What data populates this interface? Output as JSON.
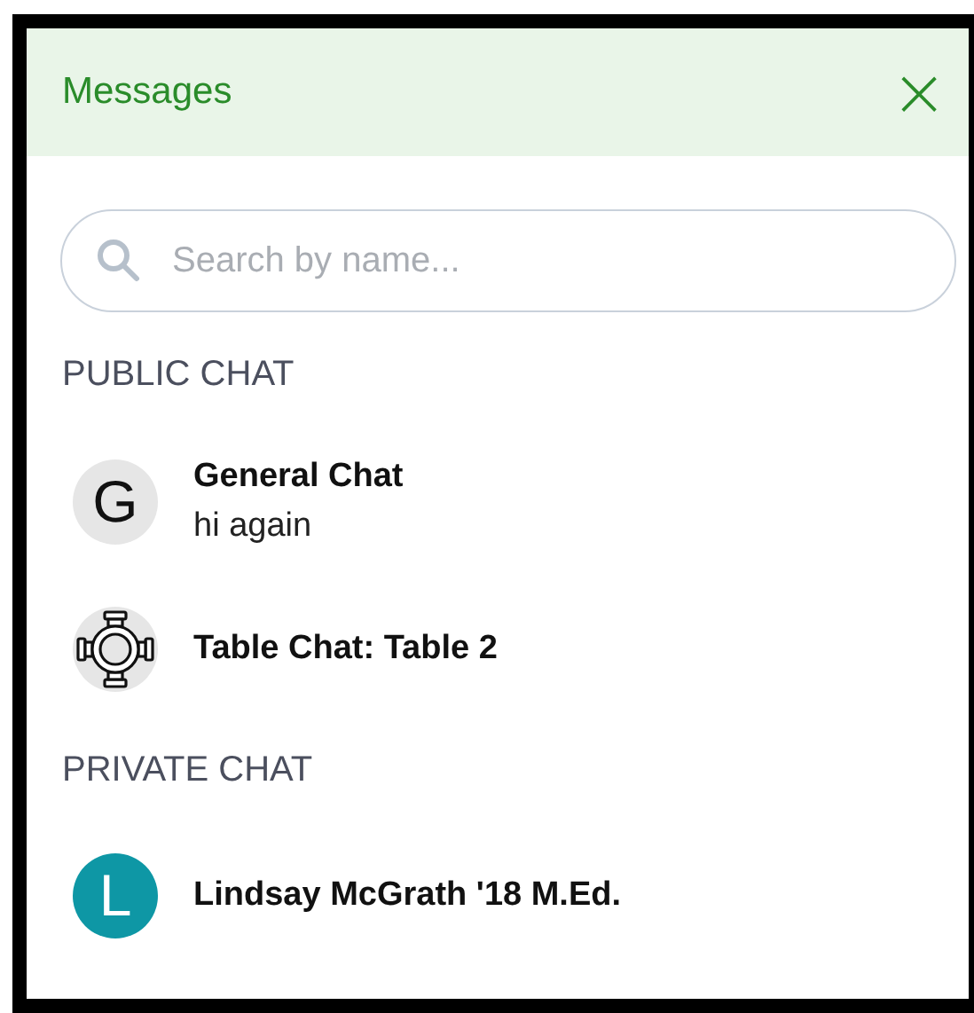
{
  "panel": {
    "title": "Messages",
    "close": "×"
  },
  "search": {
    "placeholder": "Search by name..."
  },
  "sections": [
    {
      "heading": "PUBLIC CHAT",
      "chats": [
        {
          "name": "General Chat",
          "preview": "hi again",
          "avatar": {
            "kind": "letter",
            "letter": "G",
            "color": "#e6e6e6"
          }
        },
        {
          "name": "Table Chat: Table 2",
          "avatar": {
            "kind": "table",
            "color": "#e6e6e6"
          }
        }
      ]
    },
    {
      "heading": "PRIVATE CHAT",
      "chats": [
        {
          "name": "Lindsay McGrath '18 M.Ed.",
          "avatar": {
            "kind": "letter",
            "letter": "L",
            "color": "#0e97a5"
          }
        }
      ]
    }
  ]
}
